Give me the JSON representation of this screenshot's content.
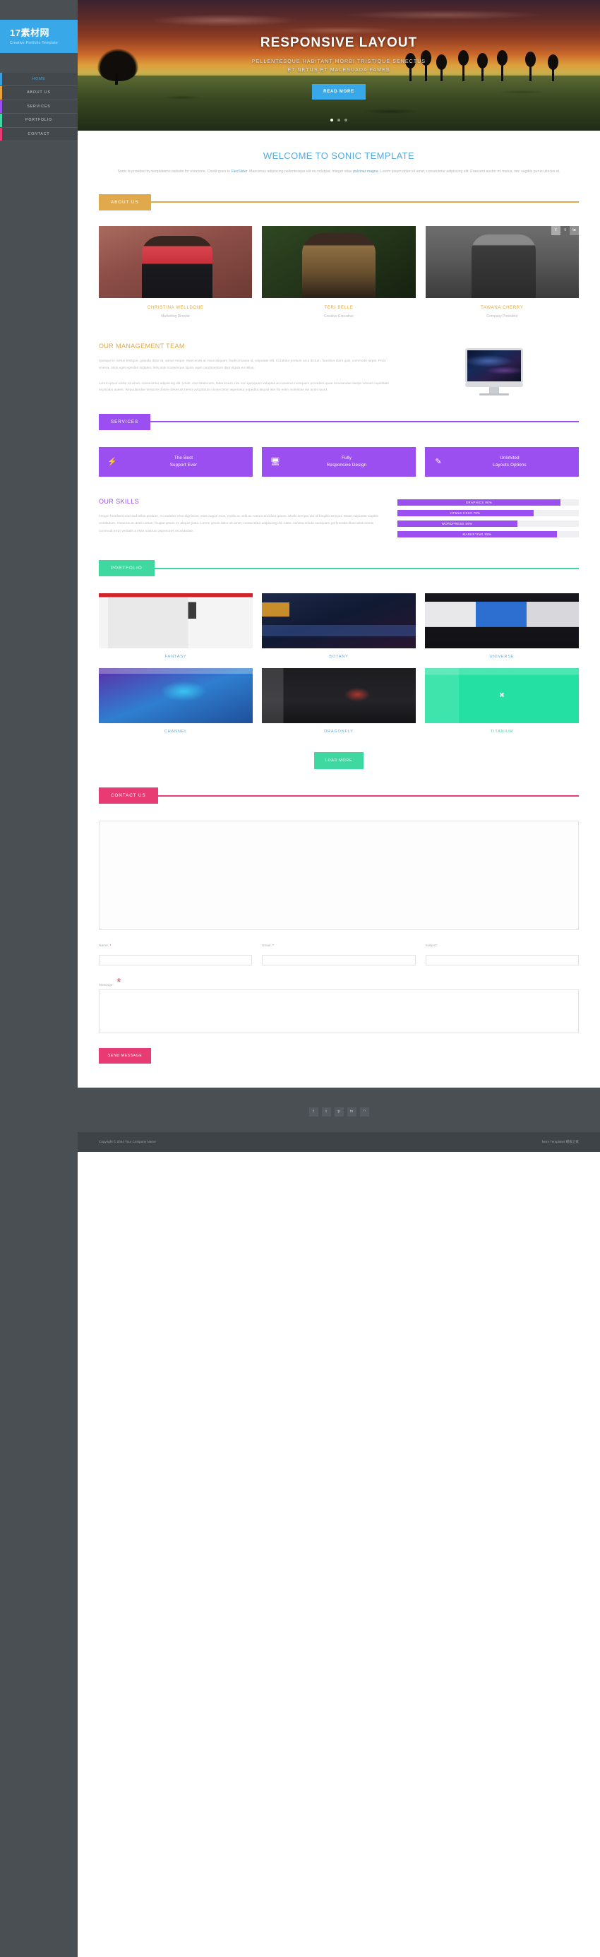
{
  "sidebar": {
    "logo_title": "17素材网",
    "logo_subtitle": "Creative Portfolio Template",
    "items": [
      {
        "label": "HOME",
        "color": "#3aa0e0",
        "active": true
      },
      {
        "label": "ABOUT US",
        "color": "#e8a33d",
        "active": false
      },
      {
        "label": "SERVICES",
        "color": "#9b4ff0",
        "active": false
      },
      {
        "label": "PORTFOLIO",
        "color": "#3ed8a0",
        "active": false
      },
      {
        "label": "CONTACT",
        "color": "#e83b74",
        "active": false
      }
    ]
  },
  "hero": {
    "title": "RESPONSIVE LAYOUT",
    "subtitle_line1": "PELLENTESQUE HABITANT MORBI TRISTIQUE SENECTUS",
    "subtitle_line2": "ET NETUS ET MALESUADA FAMES",
    "button": "READ MORE",
    "slide_count": 3,
    "active_slide": 1
  },
  "welcome": {
    "heading": "WELCOME TO SONIC TEMPLATE",
    "text_1": "Sonic is provided by templatemo website for everyone. Credit goes to ",
    "link_1": "FlexSlider",
    "text_2": ". Maecenas adipiscing pellentesque elit eu volutpat. Integer vitae ",
    "link_2": "pulvinar magna",
    "text_3": ". Lorem ipsum dolor sit amet, consectetur adipiscing elit. Praesent auctor mi metus, nec sagittis purus ultrices id."
  },
  "about": {
    "tag": "ABOUT US",
    "accent": "#e0a94b",
    "team": [
      {
        "name": "CHRISTINA WELLDONE",
        "role": "Marketing Director",
        "has_social": false
      },
      {
        "name": "TERI BELLE",
        "role": "Creative Executive",
        "has_social": false
      },
      {
        "name": "TAWANA CHERRY",
        "role": "Company President",
        "has_social": true
      }
    ],
    "social_icons": [
      {
        "name": "facebook-icon",
        "glyph": "f"
      },
      {
        "name": "twitter-icon",
        "glyph": "t"
      },
      {
        "name": "linkedin-icon",
        "glyph": "in"
      }
    ],
    "management": {
      "heading": "OUR MANAGEMENT TEAM",
      "para_1": "Quisque in metus tristique, gravida dolor at, varius neque. Maecenas ac risus aliquam, facilisi massa id, vulputate elit. Curabitur pretium arcu dictum, faucibus diam quis, commodo turpis. Proin viverra, risus eget egestas sodales, felis ante scelerisque ligula, eget condimentum diam ligula eu tellus.",
      "para_2": "Lorem ipsum dolor sit amet, consectetur adipiscing elit. Unde, exercitationem, laboriosam, nisi non quisquam voluptas accusamus numquam provident quae recusandae saepe veniam cupiditate explicabo autem. Repudiandae tempore dolore deserunt nemo voluptatum consectetur asperiatur expedita aliquid iste illo enim molestias vel animi quod."
    }
  },
  "services": {
    "tag": "SERVICES",
    "accent": "#9b4ff0",
    "cards": [
      {
        "icon": "bolt-icon",
        "glyph": "⚡",
        "line1": "The Best",
        "line2": "Support Ever"
      },
      {
        "icon": "laptop-icon",
        "glyph": "Ὓ5",
        "line1": "Fully",
        "line2": "Responsive Design"
      },
      {
        "icon": "pencil-icon",
        "glyph": "✎",
        "line1": "Unlimited",
        "line2": "Layouts Options"
      }
    ],
    "skills": {
      "heading": "OUR SKILLS",
      "text": "Integer hendrerit erat sed tellus pretium, eu sodales eros dignissim. Duis augue eros, mollis ac velit at, rutrum tincidunt ipsum. Morbi semper dui id fringilla semper. Etiam vulputate sagittis vestibulum. Vivamus ac ante cursus, feugiat ipsum et, aliquet justo. Lorem ipsum dolor sit amet, consectetur adipiscing elit. Iusto, minima soluta numquam perferendis illum alias omnis commodi error veritatis a esse nostrum asperiores recusandae."
    }
  },
  "chart_data": {
    "type": "bar",
    "title": "OUR SKILLS",
    "orientation": "horizontal",
    "categories": [
      "GRAPHICS",
      "HTML5 CSS3",
      "WORDPRESS",
      "MARKETING"
    ],
    "values": [
      90,
      75,
      66,
      88
    ],
    "labels": [
      "GRAPHICS 90%",
      "HTML5 CSS3 75%",
      "WORDPRESS 66%",
      "MARKETING 88%"
    ],
    "unit": "%",
    "xlim": [
      0,
      100
    ],
    "bar_color": "#9b4ff0",
    "track_color": "#f0f0f2",
    "grid": false,
    "legend": false
  },
  "portfolio": {
    "tag": "PORTFOLIO",
    "accent": "#3ed8a0",
    "items": [
      {
        "caption": "FANTASY",
        "thumb": "t-fantasy",
        "cap_color": "blue",
        "overlay": false
      },
      {
        "caption": "BOTANY",
        "thumb": "t-botany",
        "cap_color": "blue",
        "overlay": false
      },
      {
        "caption": "UNIVERSE",
        "thumb": "t-universe",
        "cap_color": "blue",
        "overlay": false
      },
      {
        "caption": "CHANNEL",
        "thumb": "t-channel",
        "cap_color": "blue",
        "overlay": false
      },
      {
        "caption": "DRAGONFLY",
        "thumb": "t-dragonfly",
        "cap_color": "blue",
        "overlay": false
      },
      {
        "caption": "TITANIUM",
        "thumb": "t-titanium",
        "cap_color": "green",
        "overlay": true
      }
    ],
    "load_more": "LOAD MORE"
  },
  "contact": {
    "tag": "CONTACT US",
    "accent": "#e83b74",
    "fields": [
      {
        "label": "Name:",
        "required": true,
        "value": "",
        "placeholder": ""
      },
      {
        "label": "Email:",
        "required": true,
        "value": "",
        "placeholder": ""
      },
      {
        "label": "Subject",
        "required": false,
        "value": "",
        "placeholder": ""
      }
    ],
    "message": {
      "label": "Message:",
      "required": true,
      "value": "",
      "placeholder": ""
    },
    "submit": "SEND MESSAGE"
  },
  "footer": {
    "social": [
      {
        "name": "facebook-icon",
        "glyph": "f"
      },
      {
        "name": "twitter-icon",
        "glyph": "t"
      },
      {
        "name": "pinterest-icon",
        "glyph": "p"
      },
      {
        "name": "linkedin-icon",
        "glyph": "in"
      },
      {
        "name": "rss-icon",
        "glyph": "◠"
      }
    ],
    "copyright": "Copyright © 2044 Your Company Name",
    "credit_prefix": "More Templates ",
    "credit_link": "模板之家"
  }
}
